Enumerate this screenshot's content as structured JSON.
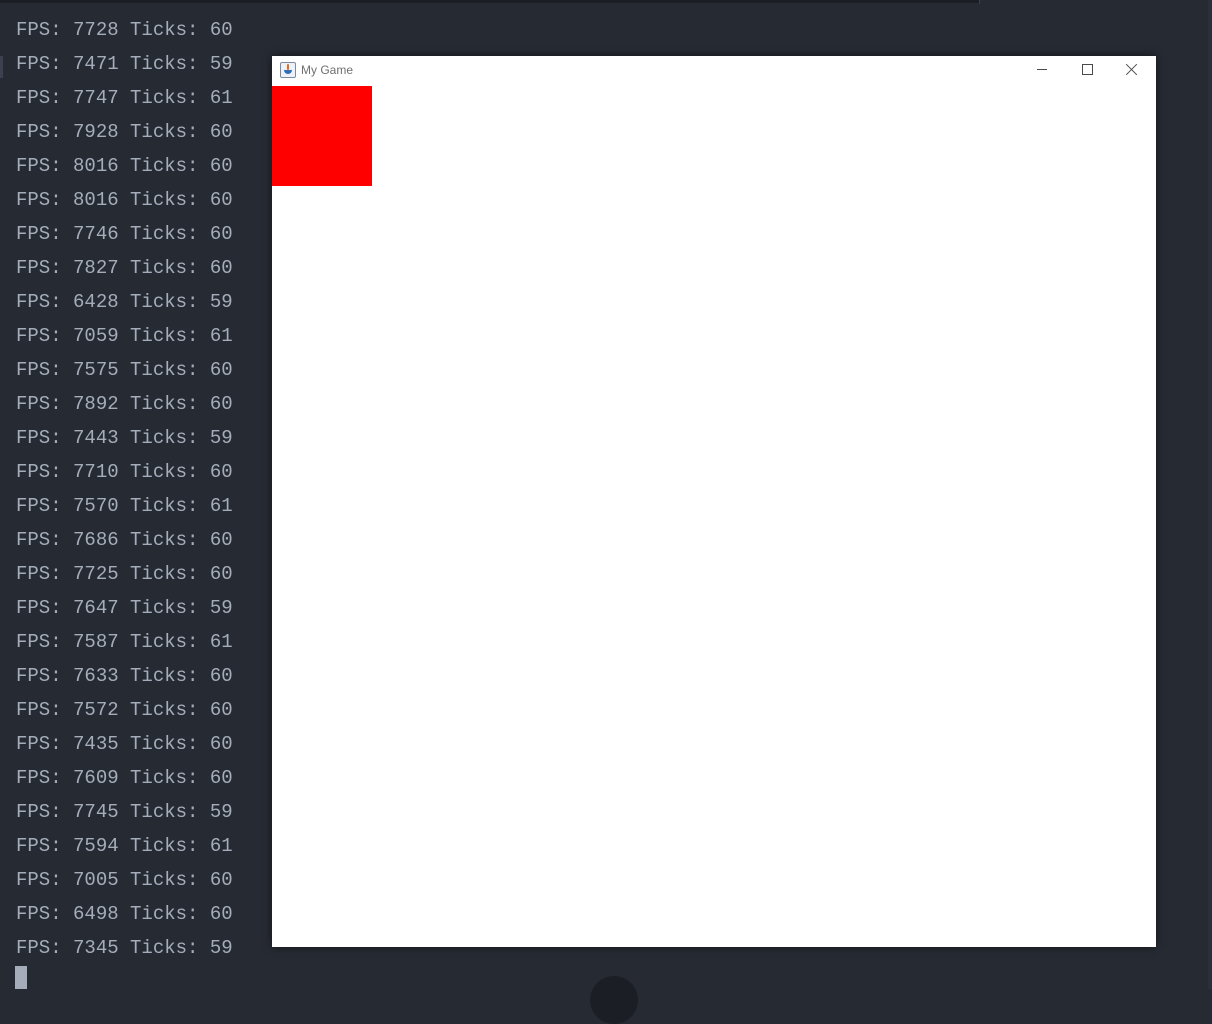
{
  "console": {
    "lines": [
      "FPS: 7728 Ticks: 60",
      "FPS: 7471 Ticks: 59",
      "FPS: 7747 Ticks: 61",
      "FPS: 7928 Ticks: 60",
      "FPS: 8016 Ticks: 60",
      "FPS: 8016 Ticks: 60",
      "FPS: 7746 Ticks: 60",
      "FPS: 7827 Ticks: 60",
      "FPS: 6428 Ticks: 59",
      "FPS: 7059 Ticks: 61",
      "FPS: 7575 Ticks: 60",
      "FPS: 7892 Ticks: 60",
      "FPS: 7443 Ticks: 59",
      "FPS: 7710 Ticks: 60",
      "FPS: 7570 Ticks: 61",
      "FPS: 7686 Ticks: 60",
      "FPS: 7725 Ticks: 60",
      "FPS: 7647 Ticks: 59",
      "FPS: 7587 Ticks: 61",
      "FPS: 7633 Ticks: 60",
      "FPS: 7572 Ticks: 60",
      "FPS: 7435 Ticks: 60",
      "FPS: 7609 Ticks: 60",
      "FPS: 7745 Ticks: 59",
      "FPS: 7594 Ticks: 61",
      "FPS: 7005 Ticks: 60",
      "FPS: 6498 Ticks: 60",
      "FPS: 7345 Ticks: 59"
    ],
    "text_color": "#a4adb9",
    "background": "#262a33"
  },
  "game_window": {
    "title": "My Game",
    "icon": "java-app-icon",
    "controls": [
      "minimize-icon",
      "maximize-icon",
      "close-icon"
    ],
    "canvas_background": "#ffffff",
    "player_color": "#ff0000"
  }
}
